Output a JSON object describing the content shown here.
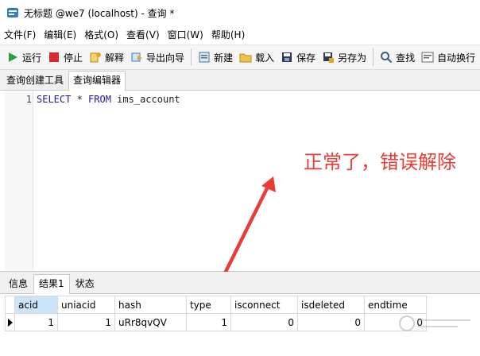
{
  "window": {
    "title": "无标题 @we7 (localhost) - 查询 *"
  },
  "menu": [
    "文件(F)",
    "编辑(E)",
    "格式(O)",
    "查看(V)",
    "窗口(W)",
    "帮助(H)"
  ],
  "toolbar": {
    "run": "运行",
    "stop": "停止",
    "explain": "解释",
    "export_wizard": "导出向导",
    "new": "新建",
    "load": "载入",
    "save": "保存",
    "save_as": "另存为",
    "find": "查找",
    "auto_wrap": "自动换行"
  },
  "tabs": [
    "查询创建工具",
    "查询编辑器"
  ],
  "editor": {
    "line_number": "1",
    "kw_select": "SELECT",
    "star": " * ",
    "kw_from": "FROM",
    "table": " ims_account"
  },
  "annotation": {
    "text": "正常了，错误解除"
  },
  "result_tabs": [
    "信息",
    "结果1",
    "状态"
  ],
  "result_grid": {
    "columns": [
      "acid",
      "uniacid",
      "hash",
      "type",
      "isconnect",
      "isdeleted",
      "endtime"
    ],
    "rows": [
      [
        "1",
        "1",
        "uRr8qvQV",
        "1",
        "0",
        "0",
        "0"
      ]
    ]
  },
  "colors": {
    "annotation": "#ea3b35",
    "selected_header": "#cce4f7",
    "keyword": "#1a1aa6"
  }
}
